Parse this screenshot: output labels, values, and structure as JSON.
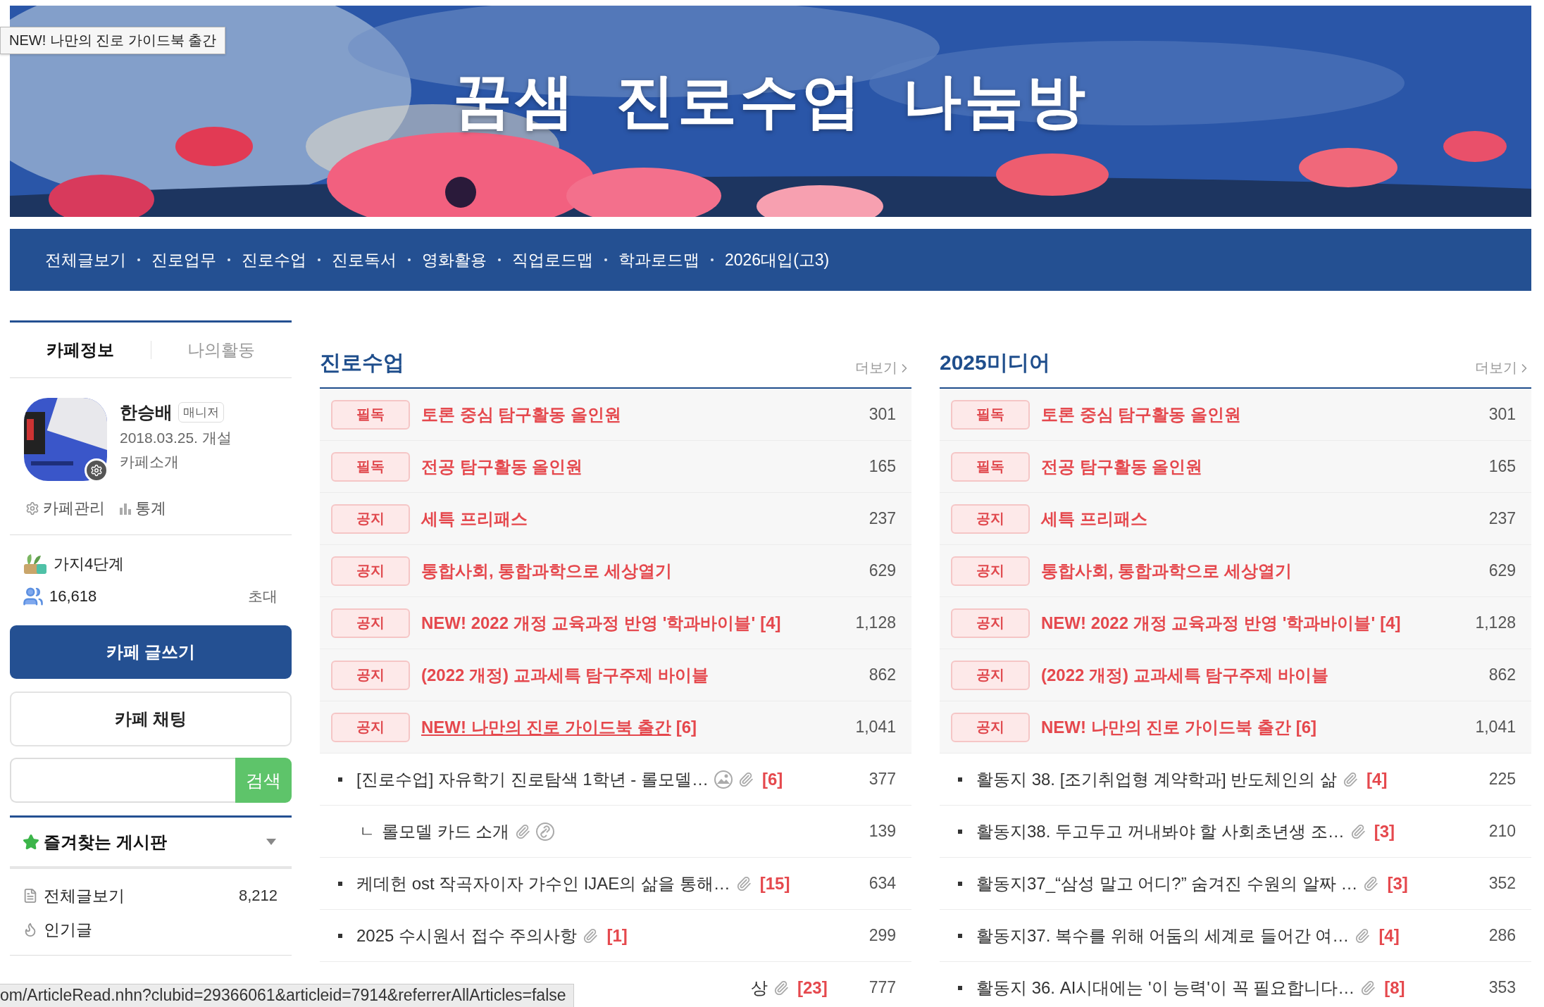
{
  "tooltip": "NEW! 나만의 진로 가이드북 출간",
  "banner": {
    "title": "꿈샘  진로수업  나눔방"
  },
  "nav": [
    "전체글보기",
    "진로업무",
    "진로수업",
    "진로독서",
    "영화활용",
    "직업로드맵",
    "학과로드맵",
    "2026대입(고3)"
  ],
  "sidebar": {
    "tabs": [
      {
        "label": "카페정보",
        "selected": true
      },
      {
        "label": "나의활동",
        "selected": false
      }
    ],
    "manager": {
      "name": "한승배",
      "role": "매니저",
      "opened": "2018.03.25. 개설",
      "intro": "카페소개"
    },
    "tools": [
      "카페관리",
      "통계"
    ],
    "level": "가지4단계",
    "members": "16,618",
    "invite": "초대",
    "write_button": "카페 글쓰기",
    "chat_button": "카페 채팅",
    "search_button": "검색",
    "favorites": {
      "title": "즐겨찾는 게시판",
      "expanded": false
    },
    "menu": [
      {
        "kind": "all",
        "label": "전체글보기",
        "count": "8,212"
      },
      {
        "kind": "popular",
        "label": "인기글"
      }
    ]
  },
  "boards": [
    {
      "title": "진로수업",
      "more": "더보기",
      "rows": [
        {
          "kind": "notice",
          "badge": "필독",
          "title": "토론 중심 탐구활동 올인원",
          "views": "301",
          "hovered": false
        },
        {
          "kind": "notice",
          "badge": "필독",
          "title": "전공 탐구활동 올인원",
          "views": "165",
          "hovered": false
        },
        {
          "kind": "notice",
          "badge": "공지",
          "title": "세특 프리패스",
          "views": "237",
          "hovered": false
        },
        {
          "kind": "notice",
          "badge": "공지",
          "title": "통합사회, 통합과학으로 세상열기",
          "views": "629",
          "hovered": false
        },
        {
          "kind": "notice",
          "badge": "공지",
          "title": "NEW! 2022 개정 교육과정 반영 '학과바이블'",
          "comments": "[4]",
          "views": "1,128",
          "hovered": false
        },
        {
          "kind": "notice",
          "badge": "공지",
          "title": "(2022 개정) 교과세특 탐구주제 바이블",
          "views": "862",
          "hovered": false
        },
        {
          "kind": "notice",
          "badge": "공지",
          "title": "NEW! 나만의 진로 가이드북 출간",
          "comments": "[6]",
          "views": "1,041",
          "hovered": true
        },
        {
          "kind": "post",
          "title": "[진로수업] 자유학기 진로탐색 1학년 - 롤모델…",
          "has_image": true,
          "has_attachment": true,
          "comments": "[6]",
          "views": "377"
        },
        {
          "kind": "reply",
          "marker": "ㄴ",
          "title": "롤모델 카드 소개",
          "has_attachment": true,
          "has_link": true,
          "views": "139"
        },
        {
          "kind": "post",
          "title": "케데헌 ost 작곡자이자 가수인 IJAE의 삶을 통해…",
          "has_attachment": true,
          "comments": "[15]",
          "views": "634"
        },
        {
          "kind": "post",
          "title": "2025 수시원서 접수 주의사항",
          "has_attachment": true,
          "comments": "[1]",
          "views": "299"
        },
        {
          "kind": "post",
          "title": "상",
          "covered": true,
          "has_attachment": true,
          "comments": "[23]",
          "views": "777"
        }
      ]
    },
    {
      "title": "2025미디어",
      "more": "더보기",
      "rows": [
        {
          "kind": "notice",
          "badge": "필독",
          "title": "토론 중심 탐구활동 올인원",
          "views": "301",
          "hovered": false
        },
        {
          "kind": "notice",
          "badge": "필독",
          "title": "전공 탐구활동 올인원",
          "views": "165",
          "hovered": false
        },
        {
          "kind": "notice",
          "badge": "공지",
          "title": "세특 프리패스",
          "views": "237",
          "hovered": false
        },
        {
          "kind": "notice",
          "badge": "공지",
          "title": "통합사회, 통합과학으로 세상열기",
          "views": "629",
          "hovered": false
        },
        {
          "kind": "notice",
          "badge": "공지",
          "title": "NEW! 2022 개정 교육과정 반영 '학과바이블'",
          "comments": "[4]",
          "views": "1,128",
          "hovered": false
        },
        {
          "kind": "notice",
          "badge": "공지",
          "title": "(2022 개정) 교과세특 탐구주제 바이블",
          "views": "862",
          "hovered": false
        },
        {
          "kind": "notice",
          "badge": "공지",
          "title": "NEW! 나만의 진로 가이드북 출간",
          "comments": "[6]",
          "views": "1,041",
          "hovered": false
        },
        {
          "kind": "post",
          "title": "활동지 38. [조기취업형 계약학과] 반도체인의 삶",
          "has_attachment": true,
          "comments": "[4]",
          "views": "225"
        },
        {
          "kind": "post",
          "title": "활동지38. 두고두고 꺼내봐야 할 사회초년생 조…",
          "has_attachment": true,
          "comments": "[3]",
          "views": "210"
        },
        {
          "kind": "post",
          "title": "활동지37_“삼성 말고 어디?” 숨겨진 수원의 알짜 …",
          "has_attachment": true,
          "comments": "[3]",
          "views": "352"
        },
        {
          "kind": "post",
          "title": "활동지37. 복수를 위해 어둠의 세계로 들어간 여…",
          "has_attachment": true,
          "comments": "[4]",
          "views": "286"
        },
        {
          "kind": "post",
          "title": "활동지 36. AI시대에는 '이 능력'이 꼭 필요합니다…",
          "has_attachment": true,
          "comments": "[8]",
          "views": "353"
        }
      ]
    }
  ],
  "status_bar": "om/ArticleRead.nhn?clubid=29366061&articleid=7914&referrerAllArticles=false"
}
